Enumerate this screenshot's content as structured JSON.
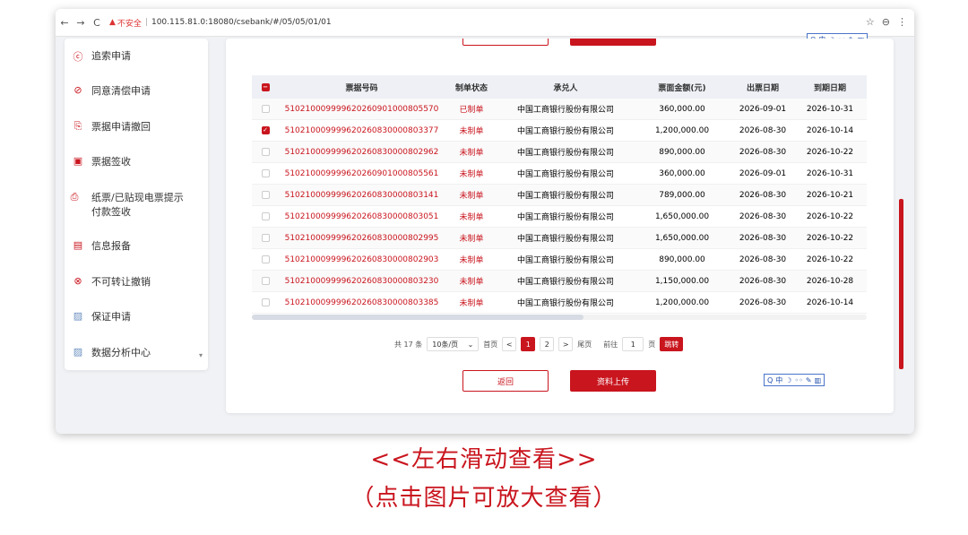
{
  "browser": {
    "nav_back": "←",
    "nav_forward": "→",
    "reload": "C",
    "insecure_label": "不安全",
    "url": "100.115.81.0:18080/csebank/#/05/05/01/01",
    "star_icon": "☆",
    "account_icon": "⊖",
    "menu_icon": "⋮"
  },
  "sidebar": {
    "items": [
      {
        "label": "追索申请",
        "icon": "ⓒ",
        "icon_name": "recourse-icon"
      },
      {
        "label": "同意清偿申请",
        "icon": "⊘",
        "icon_name": "consent-icon"
      },
      {
        "label": "票据申请撤回",
        "icon": "⎘",
        "icon_name": "withdraw-icon"
      },
      {
        "label": "票据签收",
        "icon": "▣",
        "icon_name": "sign-icon"
      },
      {
        "label": "纸票/已贴现电票提示付款签收",
        "icon": "⎙",
        "icon_name": "paper-bill-icon"
      },
      {
        "label": "信息报备",
        "icon": "▤",
        "icon_name": "report-icon"
      },
      {
        "label": "不可转让撤销",
        "icon": "⊗",
        "icon_name": "cancel-icon"
      },
      {
        "label": "保证申请",
        "icon": "▨",
        "icon_name": "image-icon"
      },
      {
        "label": "数据分析中心",
        "icon": "▨",
        "icon_name": "image-icon"
      }
    ],
    "caret": "▾"
  },
  "table": {
    "headers": [
      "票据号码",
      "制单状态",
      "承兑人",
      "票面金额(元)",
      "出票日期",
      "到期日期"
    ],
    "rows": [
      {
        "checked": false,
        "no": "510210009999620260901000805570",
        "status": "已制单",
        "acceptor": "中国工商银行股份有限公司",
        "amount": "360,000.00",
        "issue": "2026-09-01",
        "due": "2026-10-31"
      },
      {
        "checked": true,
        "no": "510210009999620260830000803377",
        "status": "未制单",
        "acceptor": "中国工商银行股份有限公司",
        "amount": "1,200,000.00",
        "issue": "2026-08-30",
        "due": "2026-10-14"
      },
      {
        "checked": false,
        "no": "510210009999620260830000802962",
        "status": "未制单",
        "acceptor": "中国工商银行股份有限公司",
        "amount": "890,000.00",
        "issue": "2026-08-30",
        "due": "2026-10-22"
      },
      {
        "checked": false,
        "no": "510210009999620260901000805561",
        "status": "未制单",
        "acceptor": "中国工商银行股份有限公司",
        "amount": "360,000.00",
        "issue": "2026-09-01",
        "due": "2026-10-31"
      },
      {
        "checked": false,
        "no": "510210009999620260830000803141",
        "status": "未制单",
        "acceptor": "中国工商银行股份有限公司",
        "amount": "789,000.00",
        "issue": "2026-08-30",
        "due": "2026-10-21"
      },
      {
        "checked": false,
        "no": "510210009999620260830000803051",
        "status": "未制单",
        "acceptor": "中国工商银行股份有限公司",
        "amount": "1,650,000.00",
        "issue": "2026-08-30",
        "due": "2026-10-22"
      },
      {
        "checked": false,
        "no": "510210009999620260830000802995",
        "status": "未制单",
        "acceptor": "中国工商银行股份有限公司",
        "amount": "1,650,000.00",
        "issue": "2026-08-30",
        "due": "2026-10-22"
      },
      {
        "checked": false,
        "no": "510210009999620260830000802903",
        "status": "未制单",
        "acceptor": "中国工商银行股份有限公司",
        "amount": "890,000.00",
        "issue": "2026-08-30",
        "due": "2026-10-22"
      },
      {
        "checked": false,
        "no": "510210009999620260830000803230",
        "status": "未制单",
        "acceptor": "中国工商银行股份有限公司",
        "amount": "1,150,000.00",
        "issue": "2026-08-30",
        "due": "2026-10-28"
      },
      {
        "checked": false,
        "no": "510210009999620260830000803385",
        "status": "未制单",
        "acceptor": "中国工商银行股份有限公司",
        "amount": "1,200,000.00",
        "issue": "2026-08-30",
        "due": "2026-10-14"
      }
    ]
  },
  "pager": {
    "total": "共 17 条",
    "page_size": "10条/页",
    "first": "首页",
    "prev": "<",
    "page1": "1",
    "page2": "2",
    "next": ">",
    "last": "尾页",
    "goto_label": "前往",
    "goto_value": "1",
    "page_unit": "页",
    "jump": "跳转"
  },
  "actions": {
    "back": "返回",
    "upload": "资料上传"
  },
  "ime": {
    "search": "Q",
    "lang": "中",
    "moon": "☽",
    "dots": "◦◦",
    "tool": "✎",
    "app": "▥"
  },
  "captions": {
    "line1": "<<左右滑动查看>>",
    "line2": "（点击图片可放大查看）"
  },
  "colors": {
    "accent": "#c9151e"
  }
}
